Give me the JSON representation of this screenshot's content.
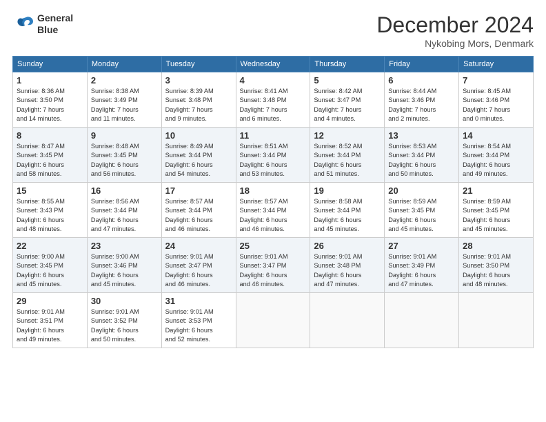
{
  "header": {
    "logo_line1": "General",
    "logo_line2": "Blue",
    "title": "December 2024",
    "subtitle": "Nykobing Mors, Denmark"
  },
  "columns": [
    "Sunday",
    "Monday",
    "Tuesday",
    "Wednesday",
    "Thursday",
    "Friday",
    "Saturday"
  ],
  "weeks": [
    [
      {
        "day": "1",
        "info": "Sunrise: 8:36 AM\nSunset: 3:50 PM\nDaylight: 7 hours\nand 14 minutes."
      },
      {
        "day": "2",
        "info": "Sunrise: 8:38 AM\nSunset: 3:49 PM\nDaylight: 7 hours\nand 11 minutes."
      },
      {
        "day": "3",
        "info": "Sunrise: 8:39 AM\nSunset: 3:48 PM\nDaylight: 7 hours\nand 9 minutes."
      },
      {
        "day": "4",
        "info": "Sunrise: 8:41 AM\nSunset: 3:48 PM\nDaylight: 7 hours\nand 6 minutes."
      },
      {
        "day": "5",
        "info": "Sunrise: 8:42 AM\nSunset: 3:47 PM\nDaylight: 7 hours\nand 4 minutes."
      },
      {
        "day": "6",
        "info": "Sunrise: 8:44 AM\nSunset: 3:46 PM\nDaylight: 7 hours\nand 2 minutes."
      },
      {
        "day": "7",
        "info": "Sunrise: 8:45 AM\nSunset: 3:46 PM\nDaylight: 7 hours\nand 0 minutes."
      }
    ],
    [
      {
        "day": "8",
        "info": "Sunrise: 8:47 AM\nSunset: 3:45 PM\nDaylight: 6 hours\nand 58 minutes."
      },
      {
        "day": "9",
        "info": "Sunrise: 8:48 AM\nSunset: 3:45 PM\nDaylight: 6 hours\nand 56 minutes."
      },
      {
        "day": "10",
        "info": "Sunrise: 8:49 AM\nSunset: 3:44 PM\nDaylight: 6 hours\nand 54 minutes."
      },
      {
        "day": "11",
        "info": "Sunrise: 8:51 AM\nSunset: 3:44 PM\nDaylight: 6 hours\nand 53 minutes."
      },
      {
        "day": "12",
        "info": "Sunrise: 8:52 AM\nSunset: 3:44 PM\nDaylight: 6 hours\nand 51 minutes."
      },
      {
        "day": "13",
        "info": "Sunrise: 8:53 AM\nSunset: 3:44 PM\nDaylight: 6 hours\nand 50 minutes."
      },
      {
        "day": "14",
        "info": "Sunrise: 8:54 AM\nSunset: 3:44 PM\nDaylight: 6 hours\nand 49 minutes."
      }
    ],
    [
      {
        "day": "15",
        "info": "Sunrise: 8:55 AM\nSunset: 3:43 PM\nDaylight: 6 hours\nand 48 minutes."
      },
      {
        "day": "16",
        "info": "Sunrise: 8:56 AM\nSunset: 3:44 PM\nDaylight: 6 hours\nand 47 minutes."
      },
      {
        "day": "17",
        "info": "Sunrise: 8:57 AM\nSunset: 3:44 PM\nDaylight: 6 hours\nand 46 minutes."
      },
      {
        "day": "18",
        "info": "Sunrise: 8:57 AM\nSunset: 3:44 PM\nDaylight: 6 hours\nand 46 minutes."
      },
      {
        "day": "19",
        "info": "Sunrise: 8:58 AM\nSunset: 3:44 PM\nDaylight: 6 hours\nand 45 minutes."
      },
      {
        "day": "20",
        "info": "Sunrise: 8:59 AM\nSunset: 3:45 PM\nDaylight: 6 hours\nand 45 minutes."
      },
      {
        "day": "21",
        "info": "Sunrise: 8:59 AM\nSunset: 3:45 PM\nDaylight: 6 hours\nand 45 minutes."
      }
    ],
    [
      {
        "day": "22",
        "info": "Sunrise: 9:00 AM\nSunset: 3:45 PM\nDaylight: 6 hours\nand 45 minutes."
      },
      {
        "day": "23",
        "info": "Sunrise: 9:00 AM\nSunset: 3:46 PM\nDaylight: 6 hours\nand 45 minutes."
      },
      {
        "day": "24",
        "info": "Sunrise: 9:01 AM\nSunset: 3:47 PM\nDaylight: 6 hours\nand 46 minutes."
      },
      {
        "day": "25",
        "info": "Sunrise: 9:01 AM\nSunset: 3:47 PM\nDaylight: 6 hours\nand 46 minutes."
      },
      {
        "day": "26",
        "info": "Sunrise: 9:01 AM\nSunset: 3:48 PM\nDaylight: 6 hours\nand 47 minutes."
      },
      {
        "day": "27",
        "info": "Sunrise: 9:01 AM\nSunset: 3:49 PM\nDaylight: 6 hours\nand 47 minutes."
      },
      {
        "day": "28",
        "info": "Sunrise: 9:01 AM\nSunset: 3:50 PM\nDaylight: 6 hours\nand 48 minutes."
      }
    ],
    [
      {
        "day": "29",
        "info": "Sunrise: 9:01 AM\nSunset: 3:51 PM\nDaylight: 6 hours\nand 49 minutes."
      },
      {
        "day": "30",
        "info": "Sunrise: 9:01 AM\nSunset: 3:52 PM\nDaylight: 6 hours\nand 50 minutes."
      },
      {
        "day": "31",
        "info": "Sunrise: 9:01 AM\nSunset: 3:53 PM\nDaylight: 6 hours\nand 52 minutes."
      },
      {
        "day": "",
        "info": ""
      },
      {
        "day": "",
        "info": ""
      },
      {
        "day": "",
        "info": ""
      },
      {
        "day": "",
        "info": ""
      }
    ]
  ]
}
